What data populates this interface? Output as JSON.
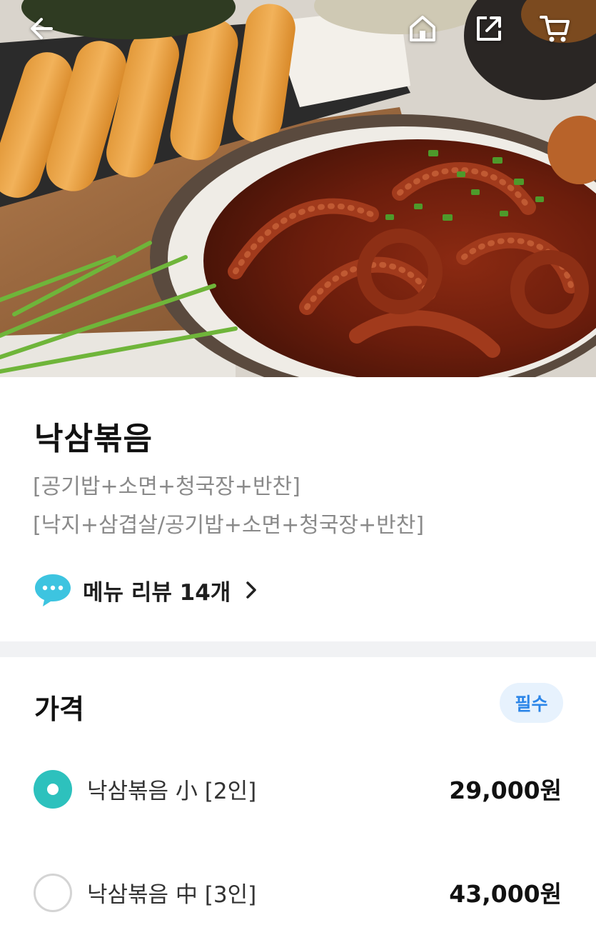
{
  "header": {
    "back_icon": "arrow-left-icon",
    "home_icon": "home-icon",
    "share_icon": "share-icon",
    "cart_icon": "cart-icon"
  },
  "menu": {
    "title": "낙삼볶음",
    "description_lines": [
      "[공기밥+소면+청국장+반찬]",
      "[낙지+삼겹살/공기밥+소면+청국장+반찬]"
    ],
    "review_link": "메뉴 리뷰 14개",
    "review_icon": "chat-bubble-icon"
  },
  "price": {
    "section_title": "가격",
    "required_badge": "필수",
    "options": [
      {
        "name": "낙삼볶음 小 [2인]",
        "price": "29,000원",
        "selected": true
      },
      {
        "name": "낙삼볶음 中 [3인]",
        "price": "43,000원",
        "selected": false
      }
    ]
  },
  "colors": {
    "accent_teal": "#2dc1bd",
    "badge_bg": "#e7f2fd",
    "badge_text": "#2c86e8",
    "desc_gray": "#8a8a8a",
    "divider": "#f1f2f4"
  }
}
